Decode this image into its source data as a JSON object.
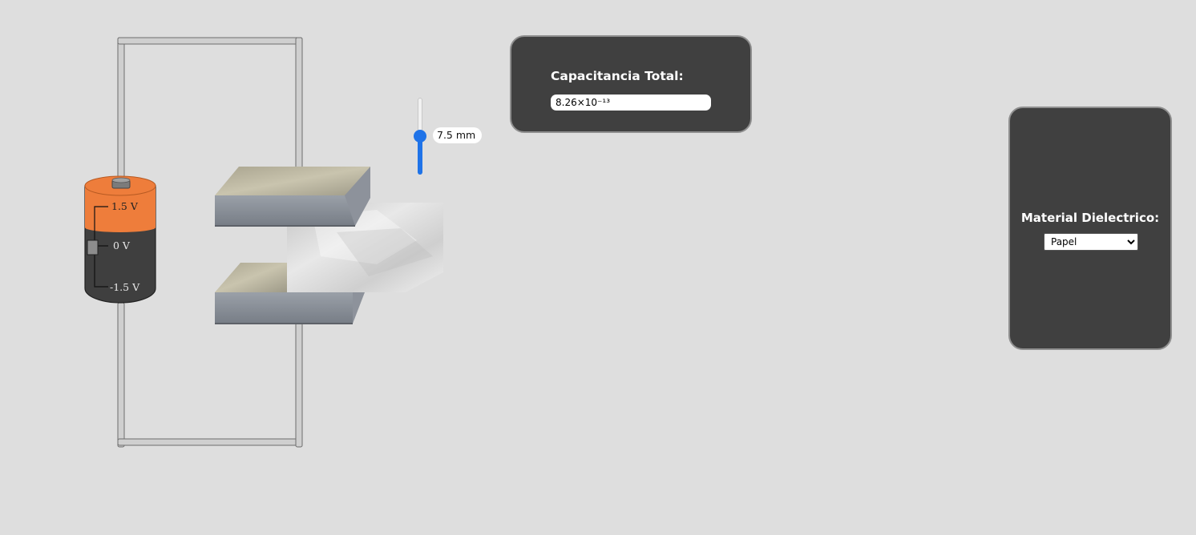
{
  "battery": {
    "top_label": "1.5  V",
    "mid_label": "0  V",
    "bottom_label": "-1.5  V"
  },
  "separation_slider": {
    "value_label": "7.5 mm",
    "level_fraction": 0.5
  },
  "capacitance_panel": {
    "title": "Capacitancia Total:",
    "value": "8.26×10⁻¹³"
  },
  "material_panel": {
    "title": "Material Dielectrico:",
    "selected": "Papel"
  },
  "colors": {
    "battery_orange": "#ee7d3b",
    "battery_body": "#3f3f3f",
    "slider_accent": "#1f73e8",
    "panel_bg": "#404040"
  }
}
